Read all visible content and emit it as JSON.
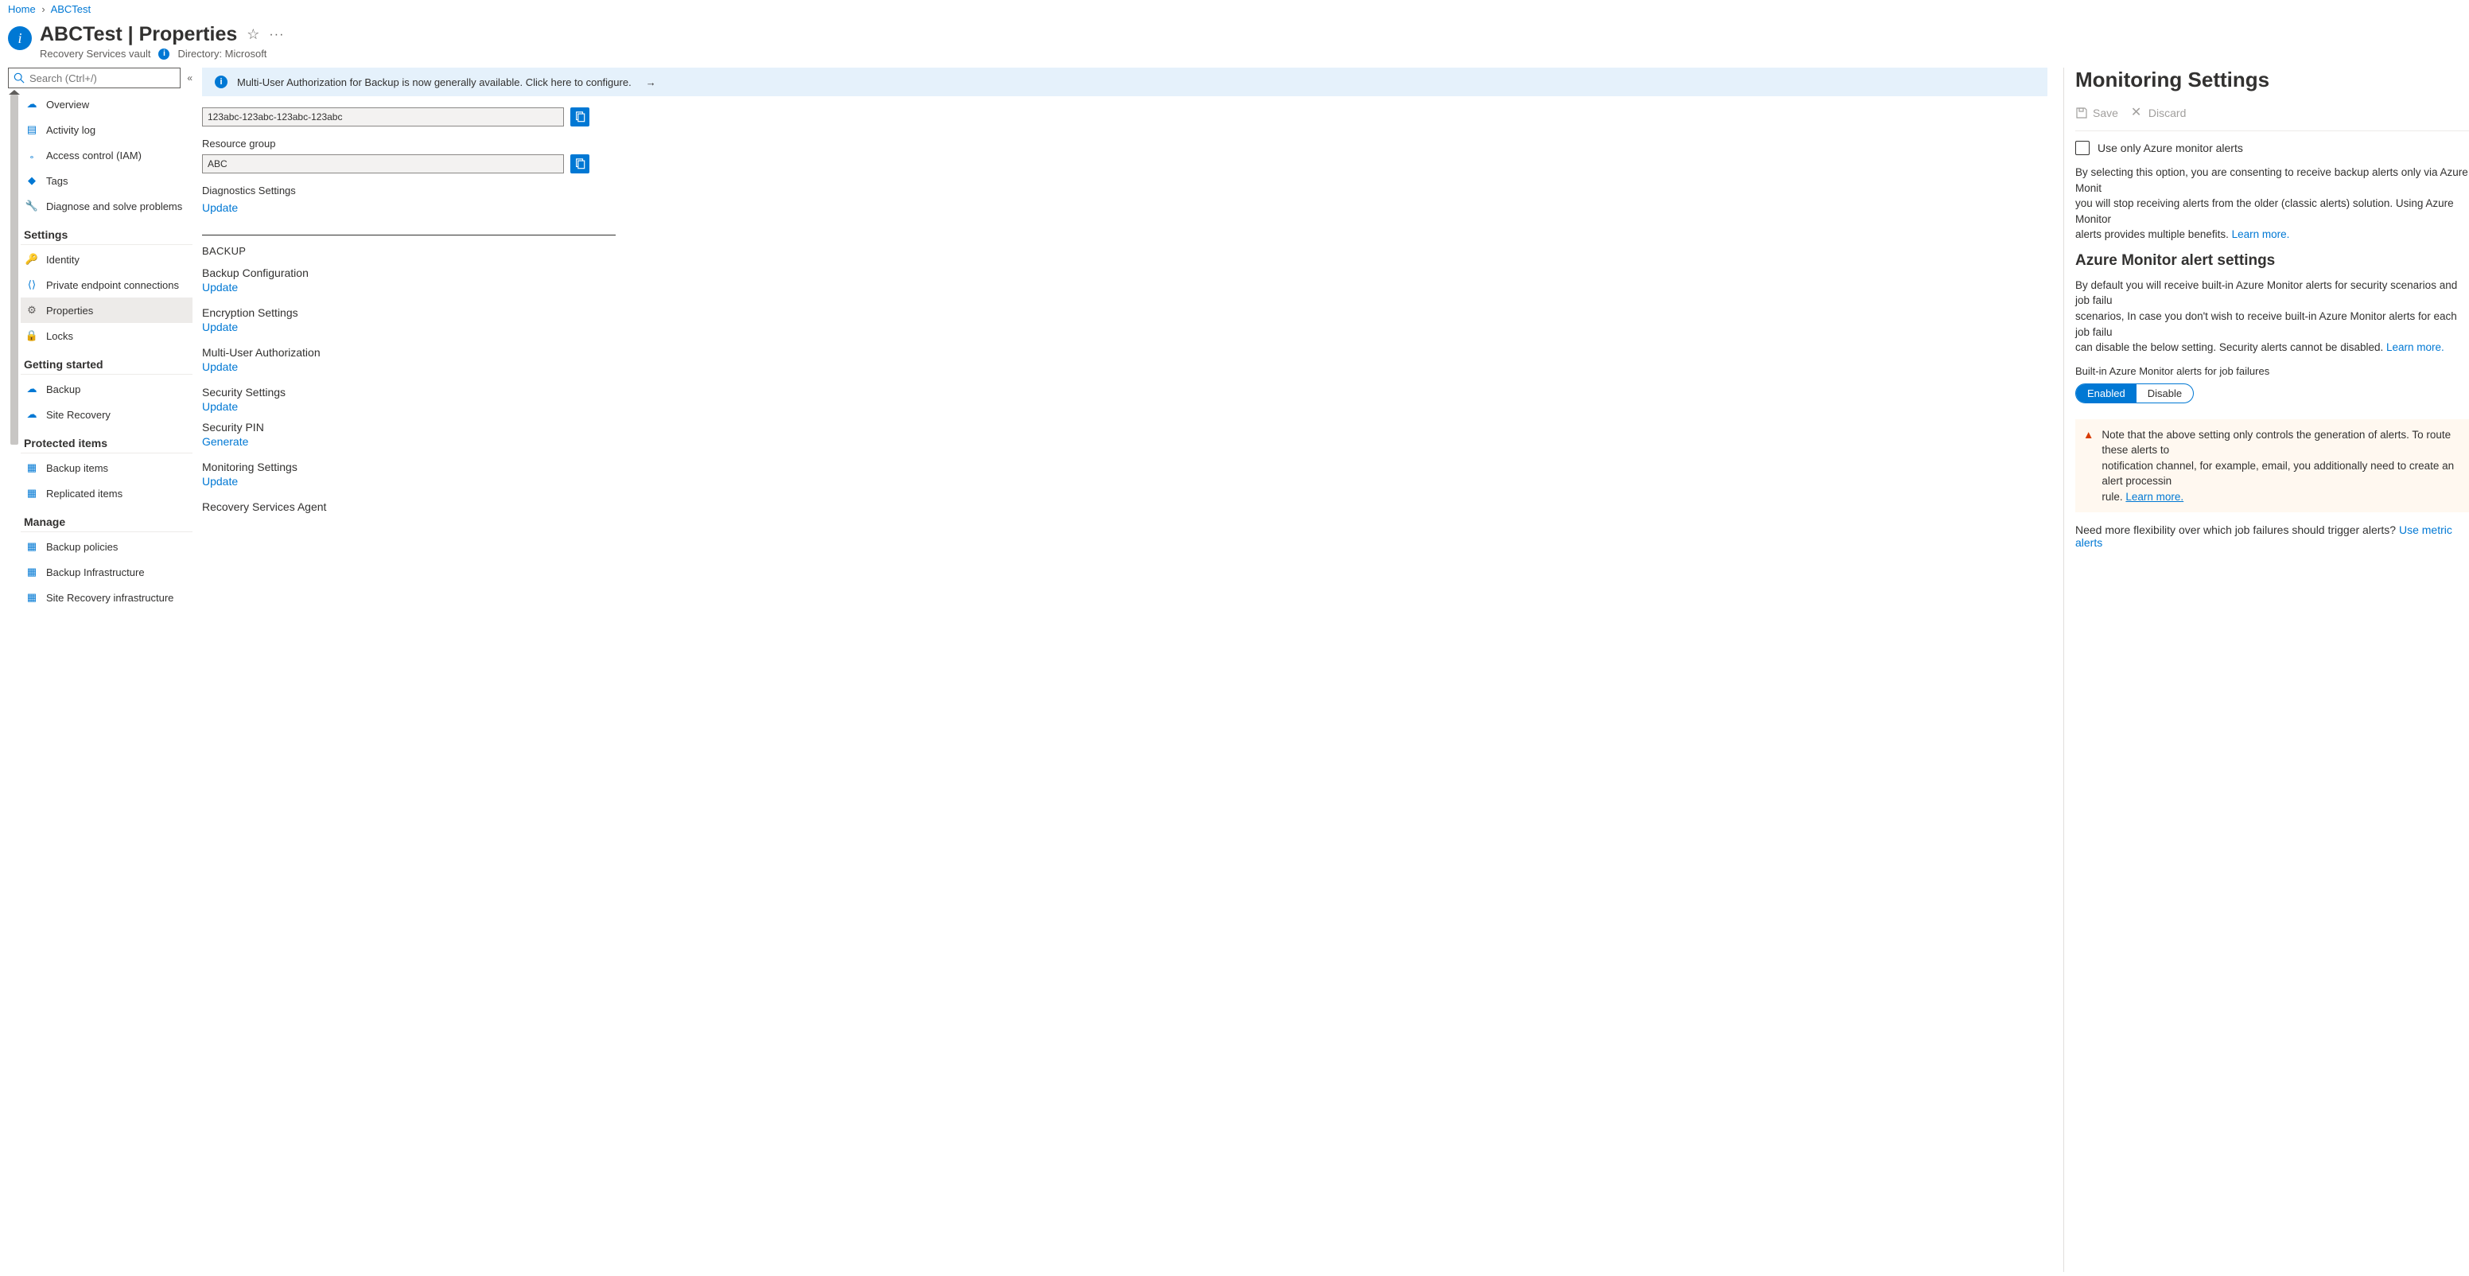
{
  "breadcrumb": {
    "home": "Home",
    "current": "ABCTest"
  },
  "header": {
    "title": "ABCTest | Properties",
    "subtitle": "Recovery Services vault",
    "directory_label": "Directory: Microsoft"
  },
  "search": {
    "placeholder": "Search (Ctrl+/)"
  },
  "sidebar": {
    "items_top": [
      {
        "label": "Overview",
        "icon": "cloud"
      },
      {
        "label": "Activity log",
        "icon": "log"
      },
      {
        "label": "Access control (IAM)",
        "icon": "people"
      },
      {
        "label": "Tags",
        "icon": "tag"
      },
      {
        "label": "Diagnose and solve problems",
        "icon": "wrench"
      }
    ],
    "section_settings": "Settings",
    "items_settings": [
      {
        "label": "Identity",
        "icon": "key"
      },
      {
        "label": "Private endpoint connections",
        "icon": "endpoint"
      },
      {
        "label": "Properties",
        "icon": "sliders",
        "active": true
      },
      {
        "label": "Locks",
        "icon": "lock"
      }
    ],
    "section_getting": "Getting started",
    "items_getting": [
      {
        "label": "Backup",
        "icon": "cloud"
      },
      {
        "label": "Site Recovery",
        "icon": "cloud"
      }
    ],
    "section_protected": "Protected items",
    "items_protected": [
      {
        "label": "Backup items",
        "icon": "grid"
      },
      {
        "label": "Replicated items",
        "icon": "grid"
      }
    ],
    "section_manage": "Manage",
    "items_manage": [
      {
        "label": "Backup policies",
        "icon": "grid"
      },
      {
        "label": "Backup Infrastructure",
        "icon": "grid"
      },
      {
        "label": "Site Recovery infrastructure",
        "icon": "grid"
      }
    ]
  },
  "center": {
    "banner": "Multi-User Authorization for Backup is now generally available. Click here to configure.",
    "id_value": "123abc-123abc-123abc-123abc",
    "rg_label": "Resource group",
    "rg_value": "ABC",
    "diag_label": "Diagnostics Settings",
    "update": "Update",
    "generate": "Generate",
    "backup_section": "BACKUP",
    "props": [
      {
        "name": "Backup Configuration",
        "action": "Update"
      },
      {
        "name": "Encryption Settings",
        "action": "Update"
      },
      {
        "name": "Multi-User Authorization",
        "action": "Update"
      },
      {
        "name": "Security Settings",
        "action": "Update"
      },
      {
        "name": "Security PIN",
        "action": "Generate"
      },
      {
        "name": "Monitoring Settings",
        "action": "Update"
      },
      {
        "name": "Recovery Services Agent",
        "action": ""
      }
    ]
  },
  "panel": {
    "title": "Monitoring Settings",
    "save": "Save",
    "discard": "Discard",
    "checkbox_label": "Use only Azure monitor alerts",
    "para1a": "By selecting this option, you are consenting to receive backup alerts only via Azure Monit",
    "para1b": "you will stop receiving alerts from the older (classic alerts) solution. Using Azure Monitor ",
    "para1c": "alerts provides multiple benefits. ",
    "learn_more": "Learn more.",
    "h3": "Azure Monitor alert settings",
    "para2a": "By default you will receive built-in Azure Monitor alerts for security scenarios and job failu",
    "para2b": "scenarios, In case you don't wish to receive built-in Azure Monitor alerts for each job failu",
    "para2c": "can disable the below setting. Security alerts cannot be disabled. ",
    "toggle_label": "Built-in Azure Monitor alerts for job failures",
    "toggle_enabled": "Enabled",
    "toggle_disable": "Disable",
    "note1": "Note that the above setting only controls the generation of alerts. To route these alerts to",
    "note2": "notification channel, for example, email, you additionally need to create an alert processin",
    "note3": "rule. ",
    "flex_q": "Need more flexibility over which job failures should trigger alerts? ",
    "flex_link": "Use metric alerts"
  }
}
